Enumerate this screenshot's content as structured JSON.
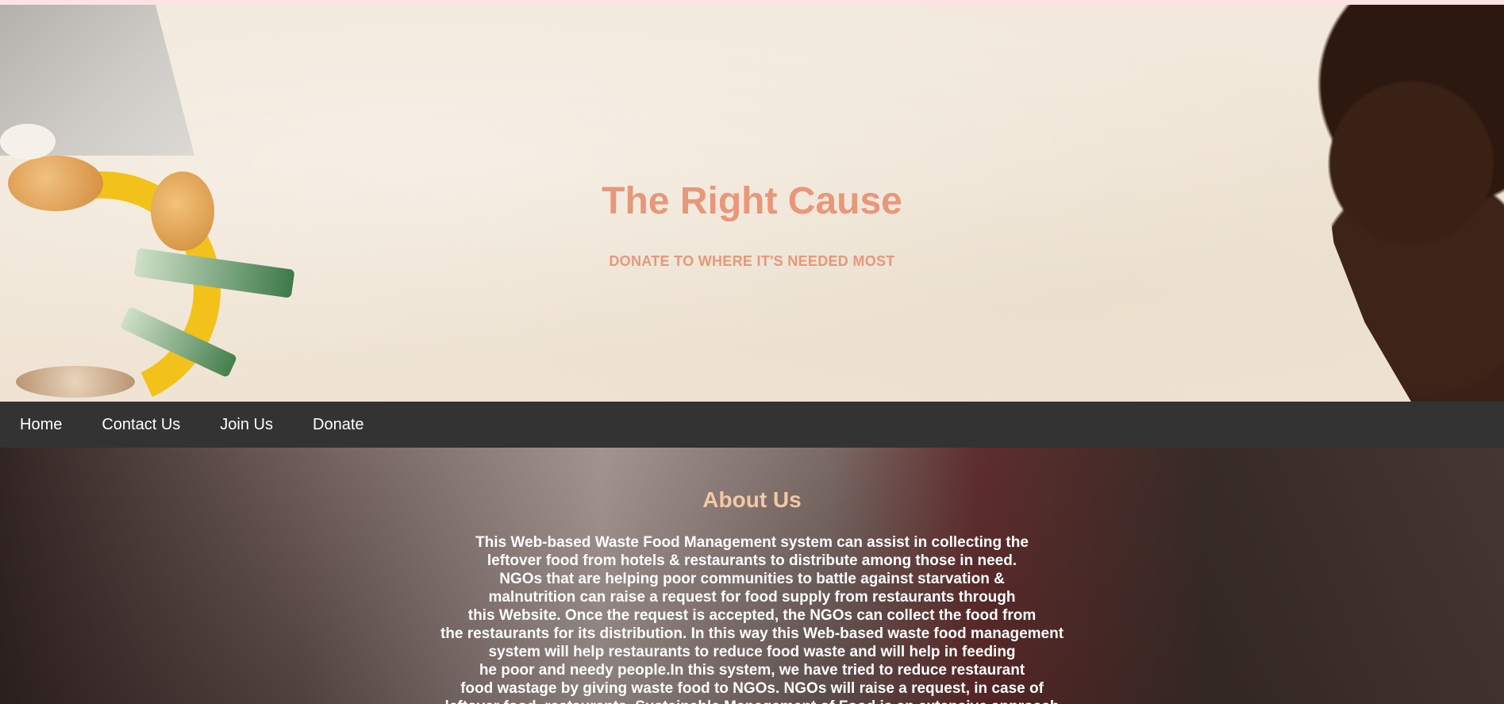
{
  "hero": {
    "title": "The Right Cause",
    "subtitle": "DONATE TO WHERE IT'S NEEDED MOST"
  },
  "nav": {
    "items": [
      {
        "label": "Home"
      },
      {
        "label": "Contact Us"
      },
      {
        "label": "Join Us"
      },
      {
        "label": "Donate"
      }
    ]
  },
  "about": {
    "title": "About Us",
    "lines": [
      "This Web-based Waste Food Management system can assist in collecting the",
      "leftover food from hotels & restaurants to distribute among those in need.",
      "NGOs that are helping poor communities to battle against starvation &",
      "malnutrition can raise a request for food supply from restaurants through",
      "this Website. Once the request is accepted, the NGOs can collect the food from",
      "the restaurants for its distribution. In this way this Web-based waste food management",
      "system will help restaurants to reduce food waste and will help in feeding",
      "he poor and needy people.In this system, we have tried to reduce restaurant",
      "food wastage by giving waste food to NGOs. NGOs will raise a request, in case of",
      "leftover food, restaurants. Sustainable Management of Food is an extensive approach"
    ]
  }
}
